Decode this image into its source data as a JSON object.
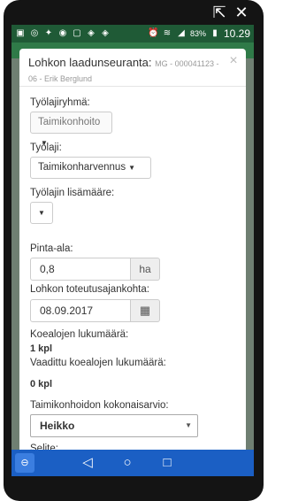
{
  "device": {
    "top_controls": {
      "expand_icon": "expand-icon",
      "close_icon": "close-icon"
    }
  },
  "statusbar": {
    "time": "10.29",
    "battery": "83%",
    "icons": [
      "notification-icon",
      "app-icon",
      "twitter-icon",
      "eye-icon",
      "app-icon",
      "maps-icon",
      "maps-icon"
    ]
  },
  "modal": {
    "title": "Lohkon laadunseuranta:",
    "subtitle": "MG - 000041123 - 06 - Erik Berglund",
    "close_label": "×",
    "fields": {
      "worktype_group_label": "Työlajiryhmä:",
      "worktype_group_value": "Taimikonhoito",
      "worktype_label": "Työlaji:",
      "worktype_value": "Taimikonharvennus",
      "worktype_extra_label": "Työlajin lisämääre:",
      "area_label": "Pinta-ala:",
      "area_value": "0,8",
      "area_unit": "ha",
      "date_label": "Lohkon toteutusajankohta:",
      "date_value": "08.09.2017",
      "sample_count_label": "Koealojen lukumäärä:",
      "sample_count_value": "1 kpl",
      "required_samples_label": "Vaadittu koealojen lukumäärä:",
      "required_samples_value": "0 kpl",
      "overall_label": "Taimikonhoidon kokonaisarvio:",
      "overall_value": "Heikko",
      "notes_label": "Selite:"
    }
  },
  "navbar": {
    "icons": [
      "app-switch-icon",
      "back-icon",
      "home-icon",
      "recents-icon"
    ]
  },
  "colors": {
    "statusbar": "#1f5a36",
    "navbar": "#1b5fc4"
  }
}
